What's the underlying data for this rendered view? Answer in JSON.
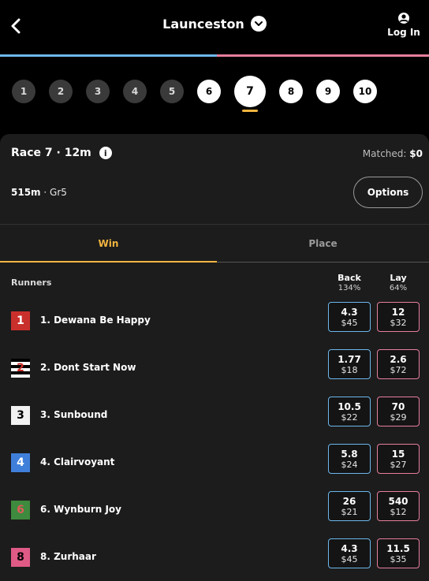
{
  "header": {
    "title": "Launceston",
    "login_label": "Log In"
  },
  "races": [
    "1",
    "2",
    "3",
    "4",
    "5",
    "6",
    "7",
    "8",
    "9",
    "10"
  ],
  "race": {
    "title": "Race 7 · 12m",
    "matched_label": "Matched:",
    "matched_value": "$0",
    "distance": "515m",
    "grade": "Gr5",
    "options_label": "Options"
  },
  "tabs": {
    "win": "Win",
    "place": "Place"
  },
  "columns": {
    "runners": "Runners",
    "back": "Back",
    "back_pct": "134%",
    "lay": "Lay",
    "lay_pct": "64%"
  },
  "runners": [
    {
      "number": "1",
      "name": "1. Dewana Be Happy",
      "back_price": "4.3",
      "back_amount": "$45",
      "lay_price": "12",
      "lay_amount": "$32"
    },
    {
      "number": "2",
      "name": "2. Dont Start Now",
      "back_price": "1.77",
      "back_amount": "$18",
      "lay_price": "2.6",
      "lay_amount": "$72"
    },
    {
      "number": "3",
      "name": "3. Sunbound",
      "back_price": "10.5",
      "back_amount": "$22",
      "lay_price": "70",
      "lay_amount": "$29"
    },
    {
      "number": "4",
      "name": "4. Clairvoyant",
      "back_price": "5.8",
      "back_amount": "$24",
      "lay_price": "15",
      "lay_amount": "$27"
    },
    {
      "number": "6",
      "name": "6. Wynburn Joy",
      "back_price": "26",
      "back_amount": "$21",
      "lay_price": "540",
      "lay_amount": "$12"
    },
    {
      "number": "8",
      "name": "8. Zurhaar",
      "back_price": "4.3",
      "back_amount": "$45",
      "lay_price": "11.5",
      "lay_amount": "$35"
    }
  ],
  "colors": {
    "back": "#6db7ec",
    "lay": "#e77f9c",
    "active_tab": "#f4b53f",
    "silk_1": "#c9302c",
    "silk_3": "#f2f2f2",
    "silk_4": "#3f7fd9",
    "silk_6": "#3e8a3e",
    "silk_8": "#e05a86"
  }
}
